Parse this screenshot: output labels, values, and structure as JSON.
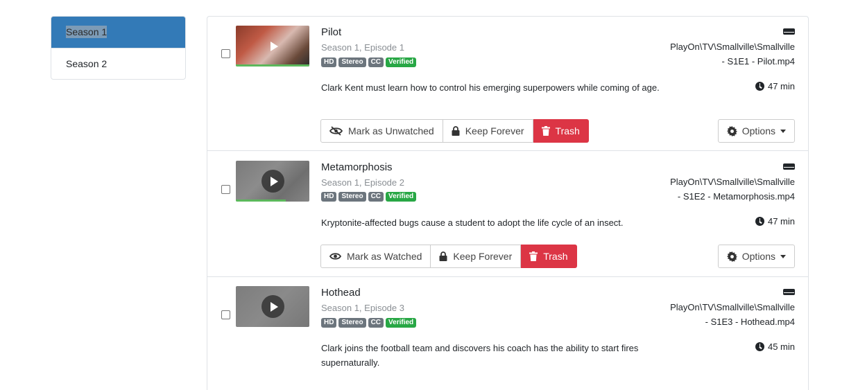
{
  "sidebar": {
    "seasons": [
      {
        "label": "Season 1",
        "active": true
      },
      {
        "label": "Season 2",
        "active": false
      }
    ]
  },
  "episodes": [
    {
      "title": "Pilot",
      "subtitle": "Season 1, Episode 1",
      "badges": [
        "HD",
        "Stereo",
        "CC",
        "Verified"
      ],
      "description": "Clark Kent must learn how to control his emerging superpowers while coming of age.",
      "path_line1": "PlayOn\\TV\\Smallville\\Smallville",
      "path_line2": "- S1E1 - Pilot.mp4",
      "duration": "47 min",
      "watch_label": "Mark as Unwatched",
      "watch_icon": "eye-slash-icon",
      "keep_label": "Keep Forever",
      "trash_label": "Trash",
      "options_label": "Options",
      "progress_fraction": 1.0
    },
    {
      "title": "Metamorphosis",
      "subtitle": "Season 1, Episode 2",
      "badges": [
        "HD",
        "Stereo",
        "CC",
        "Verified"
      ],
      "description": "Kryptonite-affected bugs cause a student to adopt the life cycle of an insect.",
      "path_line1": "PlayOn\\TV\\Smallville\\Smallville",
      "path_line2": "- S1E2 - Metamorphosis.mp4",
      "duration": "47 min",
      "watch_label": "Mark as Watched",
      "watch_icon": "eye-icon",
      "keep_label": "Keep Forever",
      "trash_label": "Trash",
      "options_label": "Options",
      "progress_fraction": 0.68
    },
    {
      "title": "Hothead",
      "subtitle": "Season 1, Episode 3",
      "badges": [
        "HD",
        "Stereo",
        "CC",
        "Verified"
      ],
      "description": "Clark joins the football team and discovers his coach has the ability to start fires supernaturally.",
      "path_line1": "PlayOn\\TV\\Smallville\\Smallville",
      "path_line2": "- S1E3 - Hothead.mp4",
      "duration": "45 min",
      "progress_fraction": 0
    }
  ],
  "colors": {
    "active_season_bg": "#337ab7",
    "trash_bg": "#dc3545",
    "verified_badge": "#28a745",
    "badge_gray": "#6c757d",
    "progress": "#5cb85c"
  }
}
